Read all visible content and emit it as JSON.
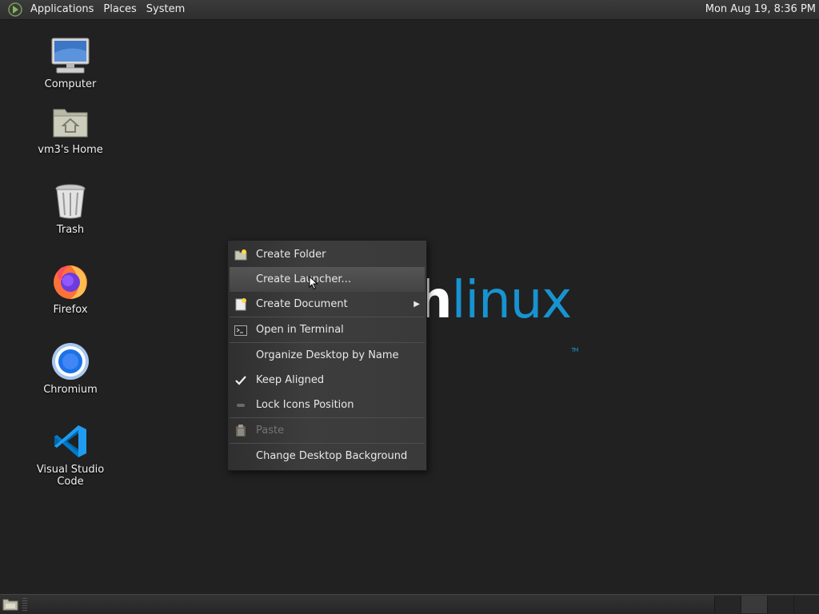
{
  "top_panel": {
    "menus": [
      "Applications",
      "Places",
      "System"
    ],
    "clock": "Mon Aug 19,  8:36 PM"
  },
  "desktop": {
    "icons": [
      {
        "label": "Computer",
        "icon": "computer-icon"
      },
      {
        "label": "vm3's Home",
        "icon": "home-folder-icon"
      },
      {
        "label": "Trash",
        "icon": "trash-icon"
      },
      {
        "label": "Firefox",
        "icon": "firefox-icon"
      },
      {
        "label": "Chromium",
        "icon": "chromium-icon"
      },
      {
        "label": "Visual Studio Code",
        "icon": "vscode-icon"
      }
    ],
    "wallpaper_text_visible": "h",
    "wallpaper_text_colored": "linux",
    "wallpaper_trademark": "TM"
  },
  "context_menu": {
    "items": [
      {
        "label": "Create Folder",
        "icon": "folder-new-icon"
      },
      {
        "label": "Create Launcher...",
        "icon": "",
        "highlighted": true
      },
      {
        "label": "Create Document",
        "icon": "document-new-icon",
        "submenu": true
      },
      {
        "label": "Open in Terminal",
        "icon": "terminal-icon"
      },
      {
        "label": "Organize Desktop by Name",
        "icon": ""
      },
      {
        "label": "Keep Aligned",
        "icon": "checkmark-icon",
        "checked": true
      },
      {
        "label": "Lock Icons Position",
        "icon": "lock-indicator-icon"
      },
      {
        "label": "Paste",
        "icon": "paste-icon",
        "disabled": true
      },
      {
        "label": "Change Desktop Background",
        "icon": ""
      }
    ]
  },
  "colors": {
    "desktop_bg": "#212121",
    "arch_blue": "#1793d1",
    "menu_highlight": "#4c4c4c",
    "disabled_text": "#747474"
  }
}
